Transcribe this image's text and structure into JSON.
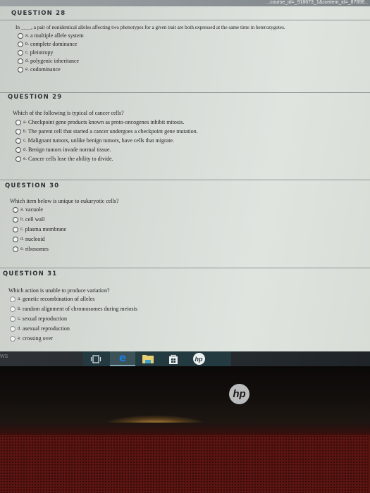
{
  "browser": {
    "url_fragment": "...course_id=_918673_1&content_id=_87898..."
  },
  "questions": [
    {
      "title": "QUESTION 28",
      "prompt": "In ____, a pair of nonidentical alleles affecting two phenotypes for a given trait are both expressed at the same time in heterozygotes.",
      "options": [
        {
          "letter": "a.",
          "text": "a multiple allele system"
        },
        {
          "letter": "b.",
          "text": "complete dominance"
        },
        {
          "letter": "c.",
          "text": "pleiotropy"
        },
        {
          "letter": "d.",
          "text": "polygenic inheritance"
        },
        {
          "letter": "e.",
          "text": "codominance"
        }
      ]
    },
    {
      "title": "QUESTION 29",
      "prompt": "Which of the following is typical of cancer cells?",
      "options": [
        {
          "letter": "a.",
          "text": "Checkpoint gene products known as proto-oncogenes inhibit mitosis."
        },
        {
          "letter": "b.",
          "text": "The parent cell that started a cancer undergoes a checkpoint gene mutation."
        },
        {
          "letter": "c.",
          "text": "Malignant tumors, unlike benign tumors, have cells that migrate."
        },
        {
          "letter": "d.",
          "text": "Benign tumors invade normal tissue."
        },
        {
          "letter": "e.",
          "text": "Cancer cells lose the ability to divide."
        }
      ]
    },
    {
      "title": "QUESTION 30",
      "prompt": "Which item below is unique to eukaryotic cells?",
      "options": [
        {
          "letter": "a.",
          "text": "vacuole"
        },
        {
          "letter": "b.",
          "text": "cell wall"
        },
        {
          "letter": "c.",
          "text": "plasma membrane"
        },
        {
          "letter": "d.",
          "text": "nucleoid"
        },
        {
          "letter": "e.",
          "text": "ribosomes"
        }
      ]
    },
    {
      "title": "QUESTION 31",
      "prompt": "Which action is unable to produce variation?",
      "options": [
        {
          "letter": "a.",
          "text": "genetic recombination of alleles"
        },
        {
          "letter": "b.",
          "text": "random alignment of chromosomes during meiosis"
        },
        {
          "letter": "c.",
          "text": "sexual reproduction"
        },
        {
          "letter": "d.",
          "text": "asexual reproduction"
        },
        {
          "letter": "e.",
          "text": "crossing over"
        }
      ]
    }
  ],
  "taskbar": {
    "search_fragment": "WS",
    "apps": [
      {
        "name": "task-view",
        "label": "Task View"
      },
      {
        "name": "edge",
        "label": "Microsoft Edge",
        "active": true
      },
      {
        "name": "file-explorer",
        "label": "File Explorer"
      },
      {
        "name": "store",
        "label": "Store"
      },
      {
        "name": "hp",
        "label": "HP"
      }
    ]
  },
  "device": {
    "bezel_logo": "hp"
  }
}
